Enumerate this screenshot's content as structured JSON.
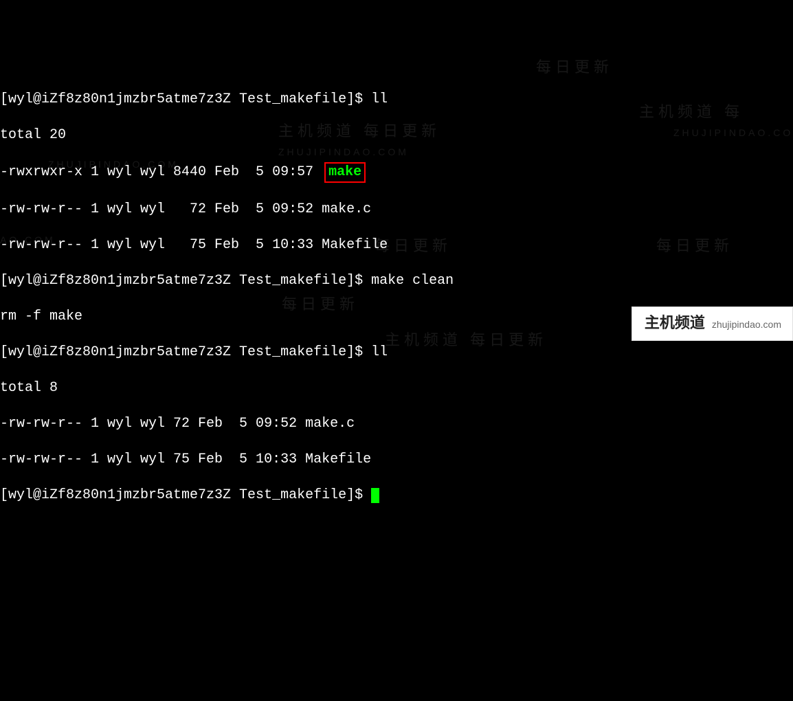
{
  "prompt": "[wyl@iZf8z80n1jmzbr5atme7z3Z Test_makefile]$ ",
  "cmd1": "ll",
  "out1_total": "total 20",
  "out1_row1_pre": "-rwxrwxr-x 1 wyl wyl 8440 Feb  5 09:57 ",
  "out1_row1_file": "make",
  "out1_row2": "-rw-rw-r-- 1 wyl wyl   72 Feb  5 09:52 make.c",
  "out1_row3": "-rw-rw-r-- 1 wyl wyl   75 Feb  5 10:33 Makefile",
  "cmd2": "make clean",
  "out2_line1": "rm -f make",
  "cmd3": "ll",
  "out3_total": "total 8",
  "out3_row1": "-rw-rw-r-- 1 wyl wyl 72 Feb  5 09:52 make.c",
  "out3_row2": "-rw-rw-r-- 1 wyl wyl 75 Feb  5 10:33 Makefile",
  "watermarks": {
    "cn_update": "每日更新",
    "cn_domain": "ZHUJIPINDAO.COM",
    "cn_domain_part": "AO.COM",
    "cn_brand_full": "主机频道 每日更新",
    "cn_brand_side": "主机频道 每"
  },
  "badge": {
    "brand_cn": "主机频道",
    "brand_url": "zhujipindao.com"
  }
}
